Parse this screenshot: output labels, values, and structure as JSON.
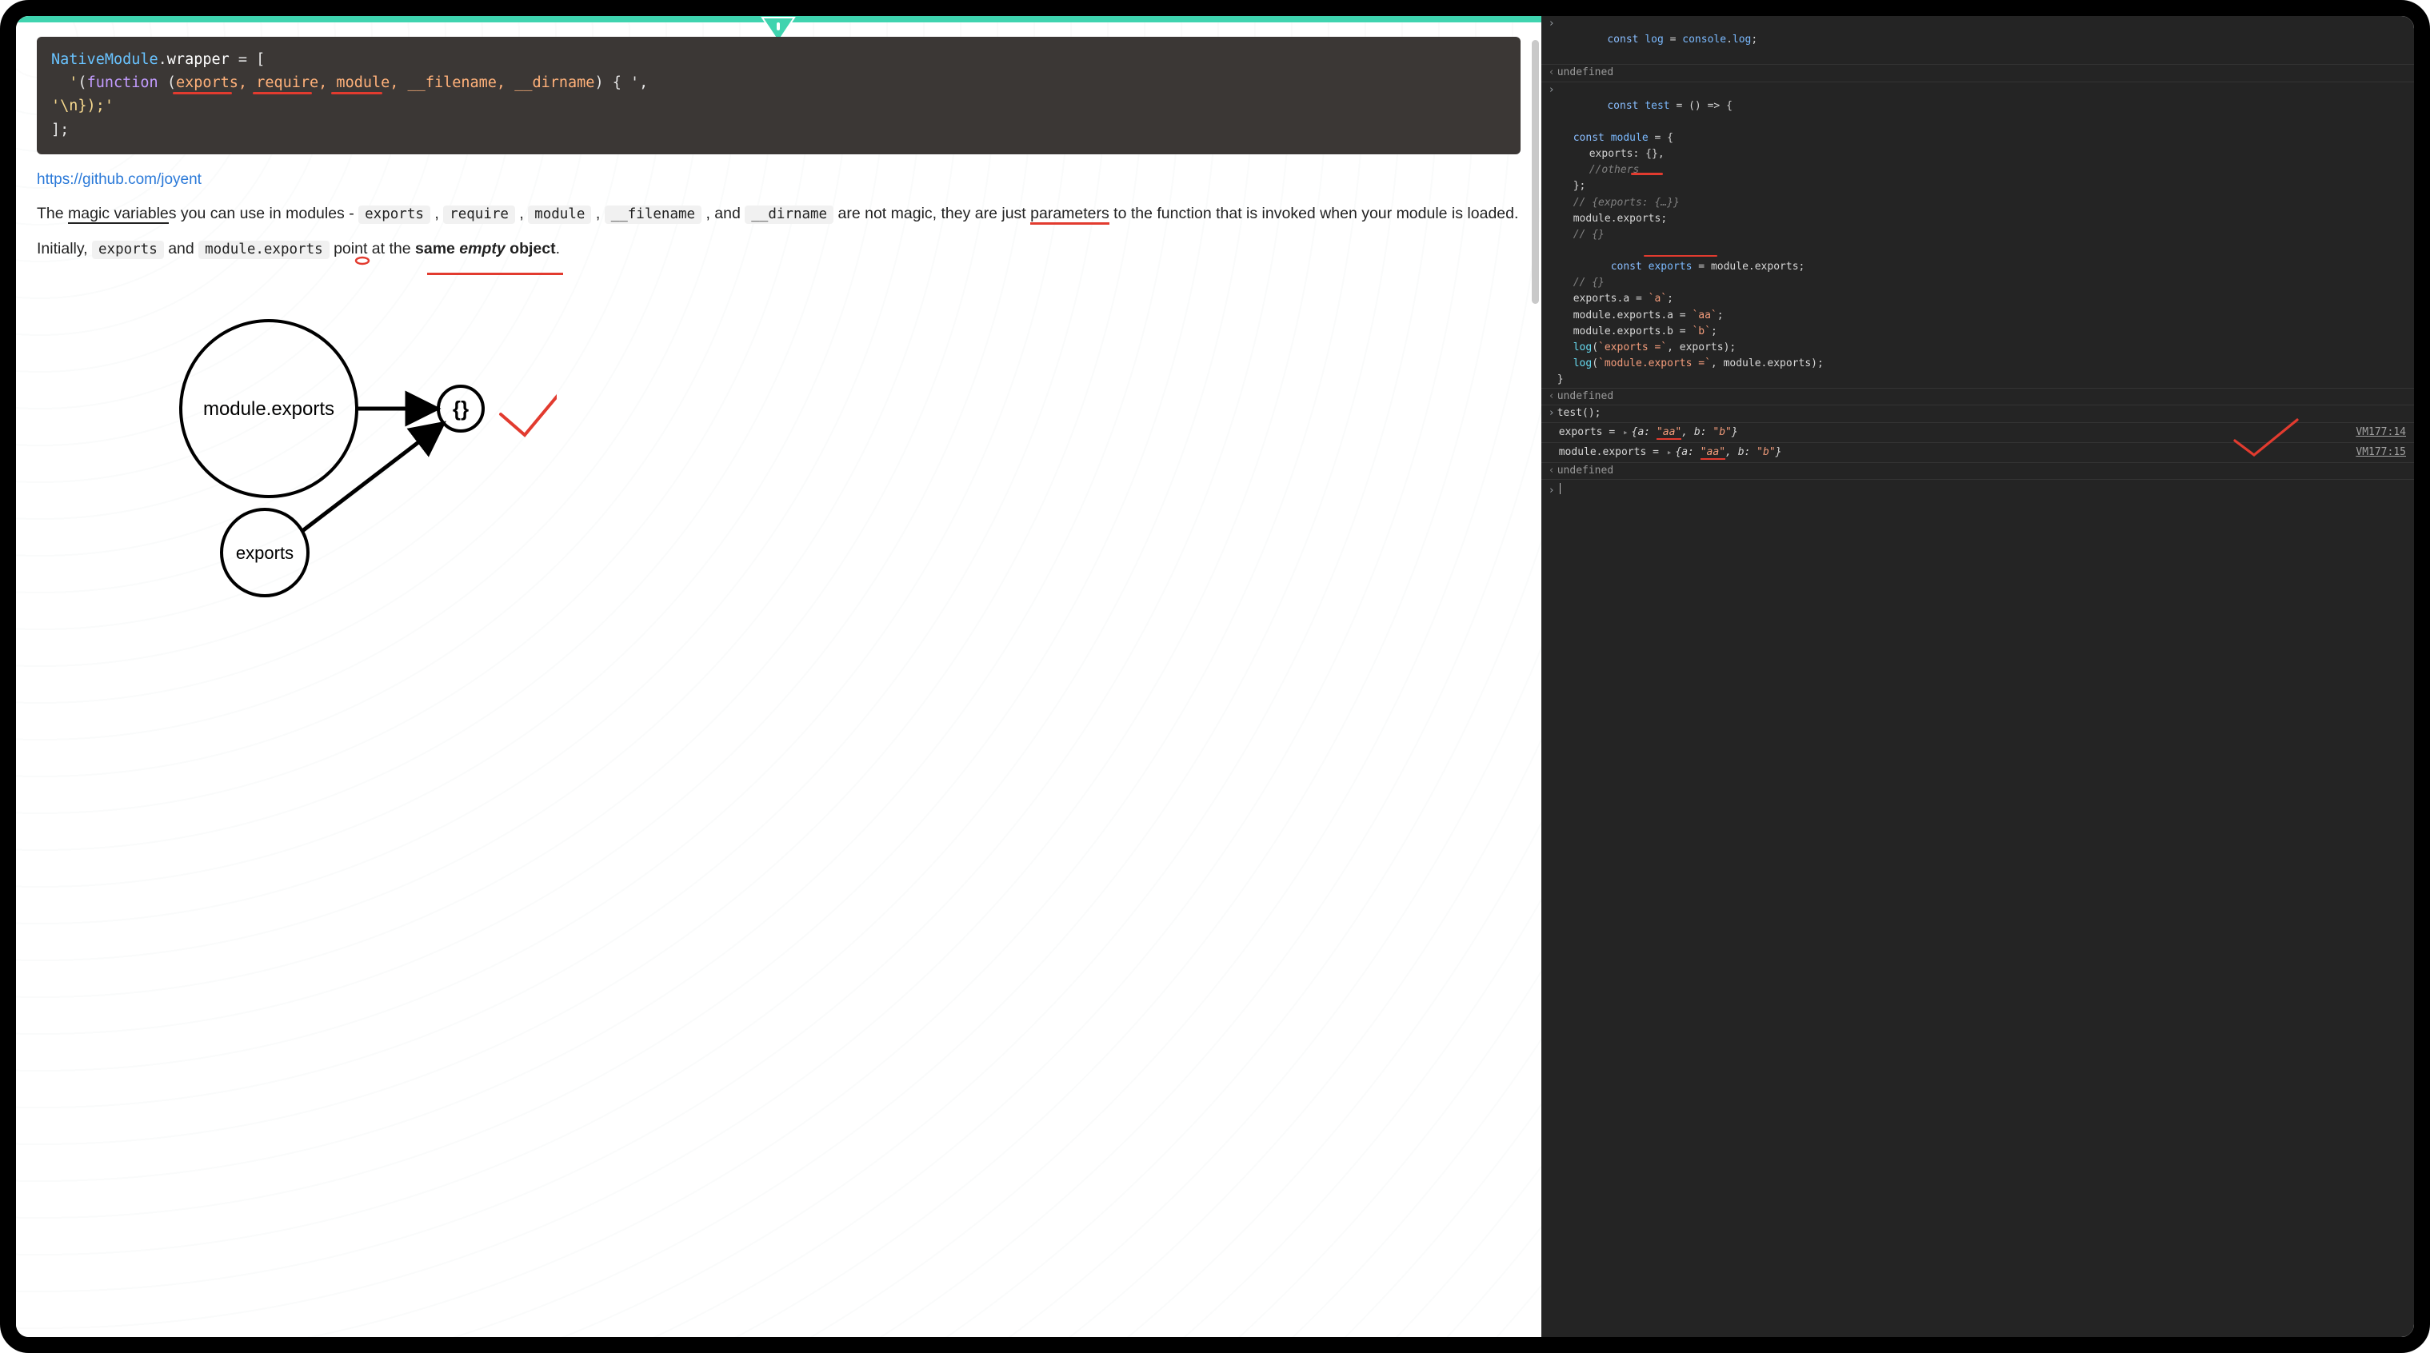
{
  "left": {
    "code": {
      "line1_a": "NativeModule",
      "line1_b": ".",
      "line1_c": "wrapper",
      "line1_d": " = [",
      "line2_pre": "  '",
      "line2_open": "(",
      "line2_fn": "function ",
      "line2_open2": "(",
      "line2_params": "exports, require, module, __filename, __dirname",
      "line2_close": ") { ',",
      "line3": "'\\n});'",
      "line4": "];"
    },
    "link": "https://github.com/joyent",
    "para1": {
      "t1": "The ",
      "u1": "magic variable",
      "t1a": "s you can use in modules - ",
      "c1": "exports",
      "t2": " , ",
      "c2": "require",
      "t3": " , ",
      "c3": "module",
      "t4": " , ",
      "c4": "__filename",
      "t5": " , and ",
      "c5": "__dirname",
      "t6": " are not magic, they are just ",
      "u2": "parameters",
      "t7": " to the function that is invoked when your module is loaded."
    },
    "para2": {
      "t1": "Initially, ",
      "c1": "exports",
      "t2": " and ",
      "c2": "module.exports",
      "t3": " point at the ",
      "b1": "same ",
      "i1": "empty",
      "b2": " object",
      "t4": "."
    },
    "diagram": {
      "big_label": "module.exports",
      "small_label": "exports",
      "target_label": "{}"
    }
  },
  "console": {
    "line1": {
      "const": "const ",
      "log": "log",
      "eq": " = ",
      "con": "console",
      "dot": ".",
      "logp": "log",
      "semi": ";"
    },
    "undef": "undefined",
    "test_header": {
      "const": "const ",
      "test": "test",
      "rest": " = () => {"
    },
    "test_body": {
      "l1a": "const ",
      "l1b": "module",
      "l1c": " = {",
      "l2a": "exports",
      "l2b": ": {},",
      "l3": "//others",
      "l4": "};",
      "l5": "// {exports: {…}}",
      "l6a": "module",
      "l6b": ".",
      "l6c": "exports",
      "l6d": ";",
      "l7": "// {}",
      "l8a": "const ",
      "l8b": "exports",
      "l8c": " = ",
      "l8d": "module",
      "l8e": ".",
      "l8f": "exports",
      "l8g": ";",
      "l9": "// {}",
      "l10a": "exports",
      "l10b": ".",
      "l10c": "a",
      "l10d": " = ",
      "l10e": "`a`",
      "l10f": ";",
      "l11a": "module",
      "l11b": ".",
      "l11c": "exports",
      "l11d": ".",
      "l11e": "a",
      "l11f": " = ",
      "l11g": "`aa`",
      "l11h": ";",
      "l12a": "module",
      "l12b": ".",
      "l12c": "exports",
      "l12d": ".",
      "l12e": "b",
      "l12f": " = ",
      "l12g": "`b`",
      "l12h": ";",
      "l13a": "log",
      "l13b": "(",
      "l13c": "`exports =`",
      "l13d": ", ",
      "l13e": "exports",
      "l13f": ");",
      "l14a": "log",
      "l14b": "(",
      "l14c": "`module.exports =`",
      "l14d": ", ",
      "l14e": "module",
      "l14f": ".",
      "l14g": "exports",
      "l14h": ");",
      "l15": "}"
    },
    "test_call": "test();",
    "out1": {
      "label": "exports = ",
      "obj_open": "{",
      "a_key": "a: ",
      "a_val": "\"aa\"",
      "sep": ", ",
      "b_key": "b: ",
      "b_val": "\"b\"",
      "obj_close": "}",
      "src": "VM177:14"
    },
    "out2": {
      "label": "module.exports = ",
      "obj_open": "{",
      "a_key": "a: ",
      "a_val": "\"aa\"",
      "sep": ", ",
      "b_key": "b: ",
      "b_val": "\"b\"",
      "obj_close": "}",
      "src": "VM177:15"
    }
  }
}
